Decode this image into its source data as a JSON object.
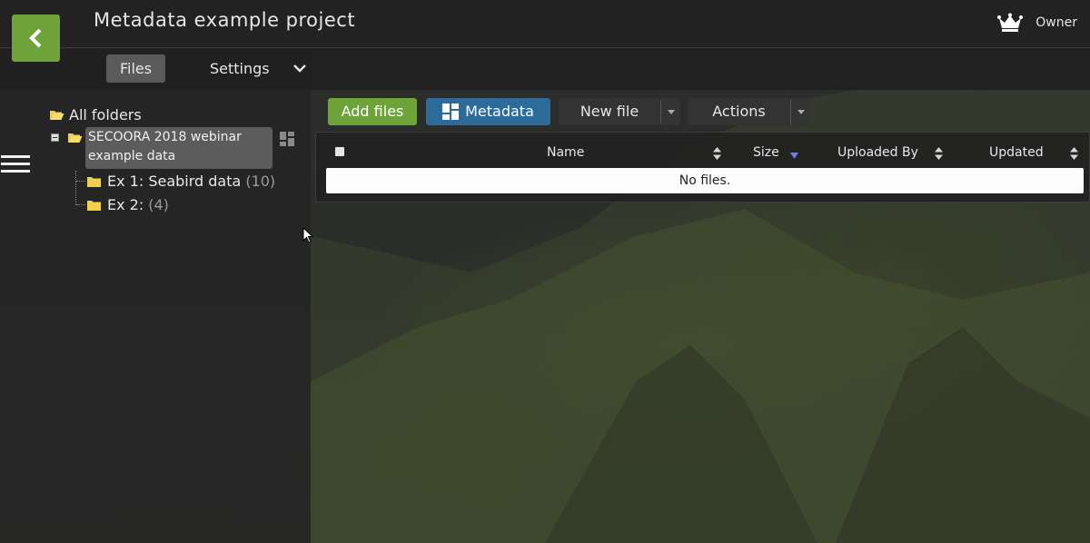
{
  "header": {
    "title": "Metadata example project",
    "role_label": "Owner"
  },
  "nav": {
    "tabs": [
      {
        "label": "Files",
        "active": true
      },
      {
        "label": "Settings",
        "active": false
      }
    ]
  },
  "tree": {
    "root_label": "All folders",
    "selected_folder": "SECOORA 2018 webinar example data",
    "children": [
      {
        "label": "Ex 1: Seabird data",
        "count": "(10)"
      },
      {
        "label": "Ex 2:",
        "count": "(4)"
      }
    ]
  },
  "toolbar": {
    "add_files": "Add files",
    "metadata": "Metadata",
    "new_file": "New file",
    "actions": "Actions"
  },
  "table": {
    "columns": [
      "Name",
      "Size",
      "Uploaded By",
      "Updated"
    ],
    "empty_message": "No files."
  },
  "colors": {
    "accent_green": "#6ea33a",
    "metadata_blue": "#2c6b9a",
    "selected_gray": "#5c5c5c"
  }
}
